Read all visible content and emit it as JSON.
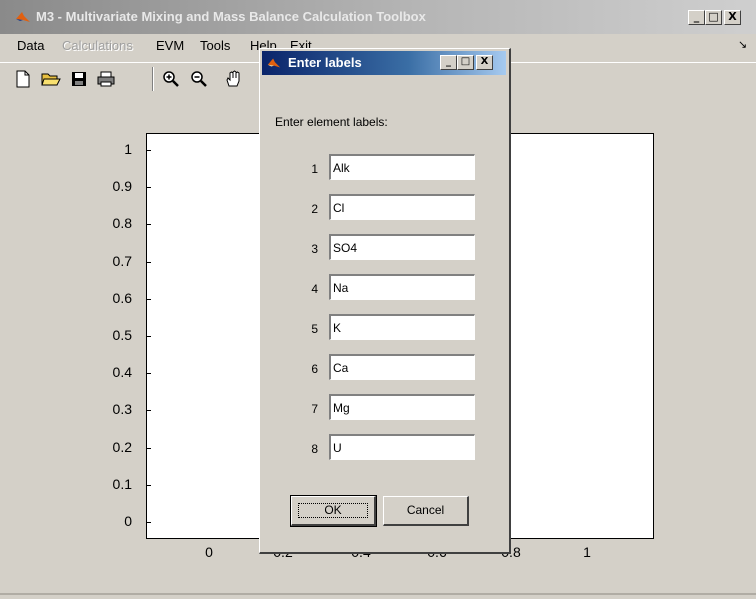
{
  "window": {
    "title": "M3 - Multivariate Mixing and Mass Balance Calculation Toolbox",
    "minimize": "_",
    "maximize": "□",
    "close": "X"
  },
  "menubar": {
    "items": [
      {
        "label": "Data",
        "enabled": true
      },
      {
        "label": "Calculations",
        "enabled": false
      },
      {
        "label": "EVM",
        "enabled": true
      },
      {
        "label": "Tools",
        "enabled": true
      },
      {
        "label": "Help",
        "enabled": true
      },
      {
        "label": "Exit",
        "enabled": true
      }
    ],
    "corner_arrow": "↘"
  },
  "toolbar": {
    "icons": [
      "new-file-icon",
      "open-folder-icon",
      "save-icon",
      "print-icon",
      "zoom-in-icon",
      "zoom-out-icon",
      "pan-hand-icon"
    ]
  },
  "plot": {
    "yticks": [
      "1",
      "0.9",
      "0.8",
      "0.7",
      "0.6",
      "0.5",
      "0.4",
      "0.3",
      "0.2",
      "0.1",
      "0"
    ],
    "xticks": [
      "0",
      "0.2",
      "0.4",
      "0.6",
      "0.8",
      "1"
    ],
    "ylim": [
      0,
      1
    ],
    "xlim": [
      -0.2,
      1.2
    ]
  },
  "dialog": {
    "title": "Enter labels",
    "minimize": "_",
    "maximize": "□",
    "close": "X",
    "prompt": "Enter element labels:",
    "rows": [
      {
        "num": "1",
        "value": "Alk"
      },
      {
        "num": "2",
        "value": "Cl"
      },
      {
        "num": "3",
        "value": "SO4"
      },
      {
        "num": "4",
        "value": "Na"
      },
      {
        "num": "5",
        "value": "K"
      },
      {
        "num": "6",
        "value": "Ca"
      },
      {
        "num": "7",
        "value": "Mg"
      },
      {
        "num": "8",
        "value": "U"
      }
    ],
    "ok_label": "OK",
    "cancel_label": "Cancel"
  },
  "colors": {
    "face": "#d4d0c8",
    "dialog_title_start": "#0a246a",
    "dialog_title_end": "#a6caf0",
    "matlab_orange": "#e06010"
  }
}
